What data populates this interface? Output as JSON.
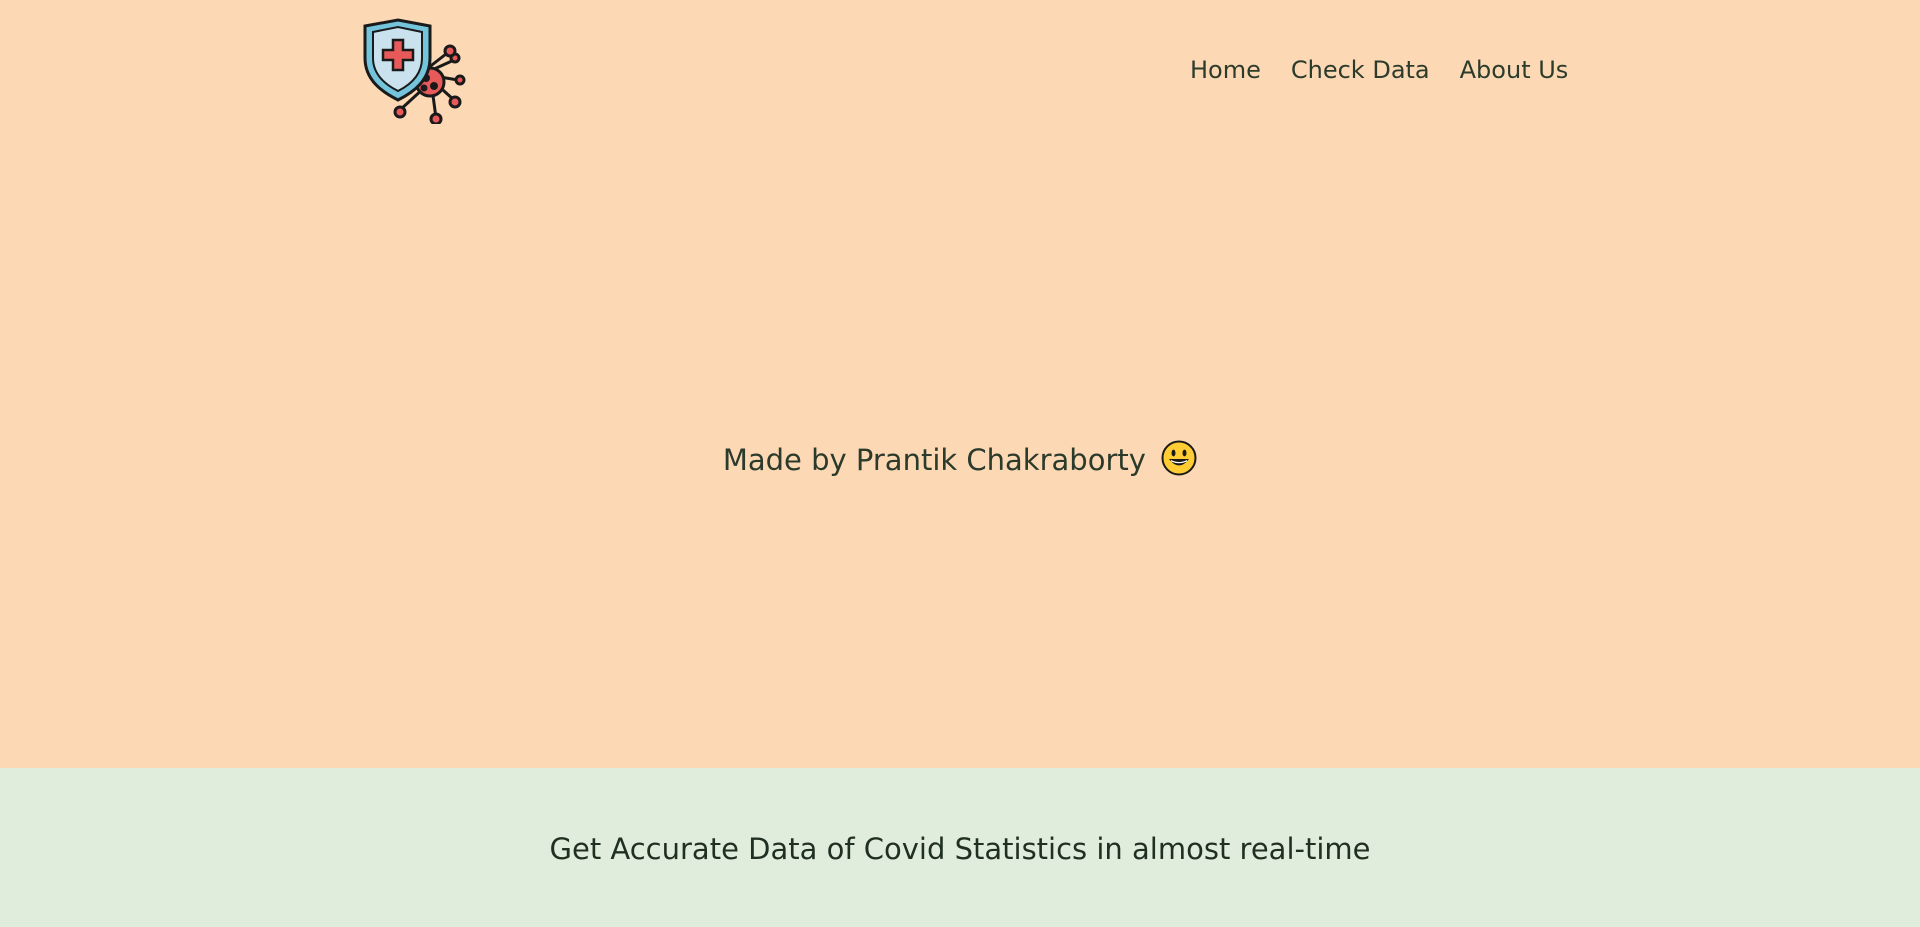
{
  "header": {
    "logo_icon": "shield-virus-icon",
    "nav": [
      {
        "label": "Home"
      },
      {
        "label": "Check Data"
      },
      {
        "label": "About Us"
      }
    ]
  },
  "hero": {
    "credit_text": "Made by Prantik Chakraborty",
    "emoji_icon": "grinning-face-icon"
  },
  "banner": {
    "tagline": "Get Accurate Data of Covid Statistics in almost real-time"
  },
  "colors": {
    "page_background": "#fcd8b4",
    "banner_background": "#e0eddc",
    "text": "#2b3a2a",
    "virus_red": "#e85a5a",
    "shield_blue": "#74c4dc"
  }
}
